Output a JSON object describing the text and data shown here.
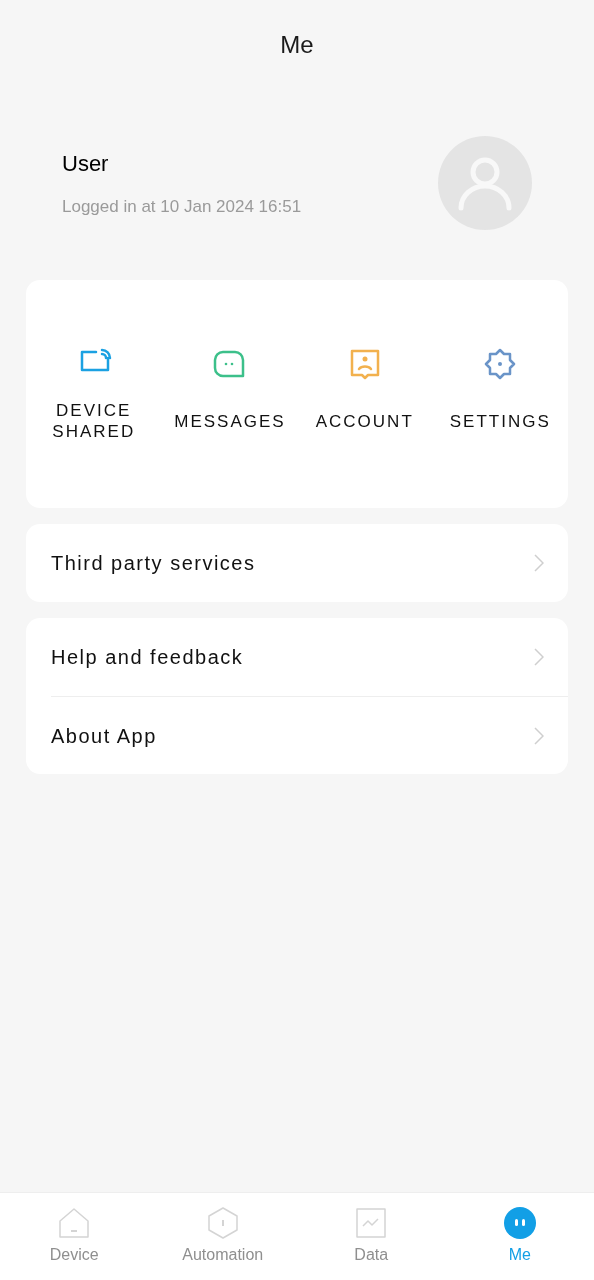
{
  "header": {
    "title": "Me"
  },
  "profile": {
    "name": "User",
    "login_info": "Logged in at 10 Jan 2024 16:51"
  },
  "shortcuts": [
    {
      "kind": "share",
      "label": "DEVICE SHARED",
      "color": "#1ba1e2"
    },
    {
      "kind": "messages",
      "label": "MESSAGES",
      "color": "#3cc08a"
    },
    {
      "kind": "account",
      "label": "ACCOUNT",
      "color": "#f2b14e"
    },
    {
      "kind": "settings",
      "label": "SETTINGS",
      "color": "#6a94c8"
    }
  ],
  "menu_groups": [
    {
      "items": [
        "Third party services"
      ]
    },
    {
      "items": [
        "Help and feedback",
        "About App"
      ]
    }
  ],
  "tabs": [
    {
      "kind": "device",
      "label": "Device",
      "selected": false
    },
    {
      "kind": "automation",
      "label": "Automation",
      "selected": false
    },
    {
      "kind": "data",
      "label": "Data",
      "selected": false
    },
    {
      "kind": "me",
      "label": "Me",
      "selected": true
    }
  ]
}
